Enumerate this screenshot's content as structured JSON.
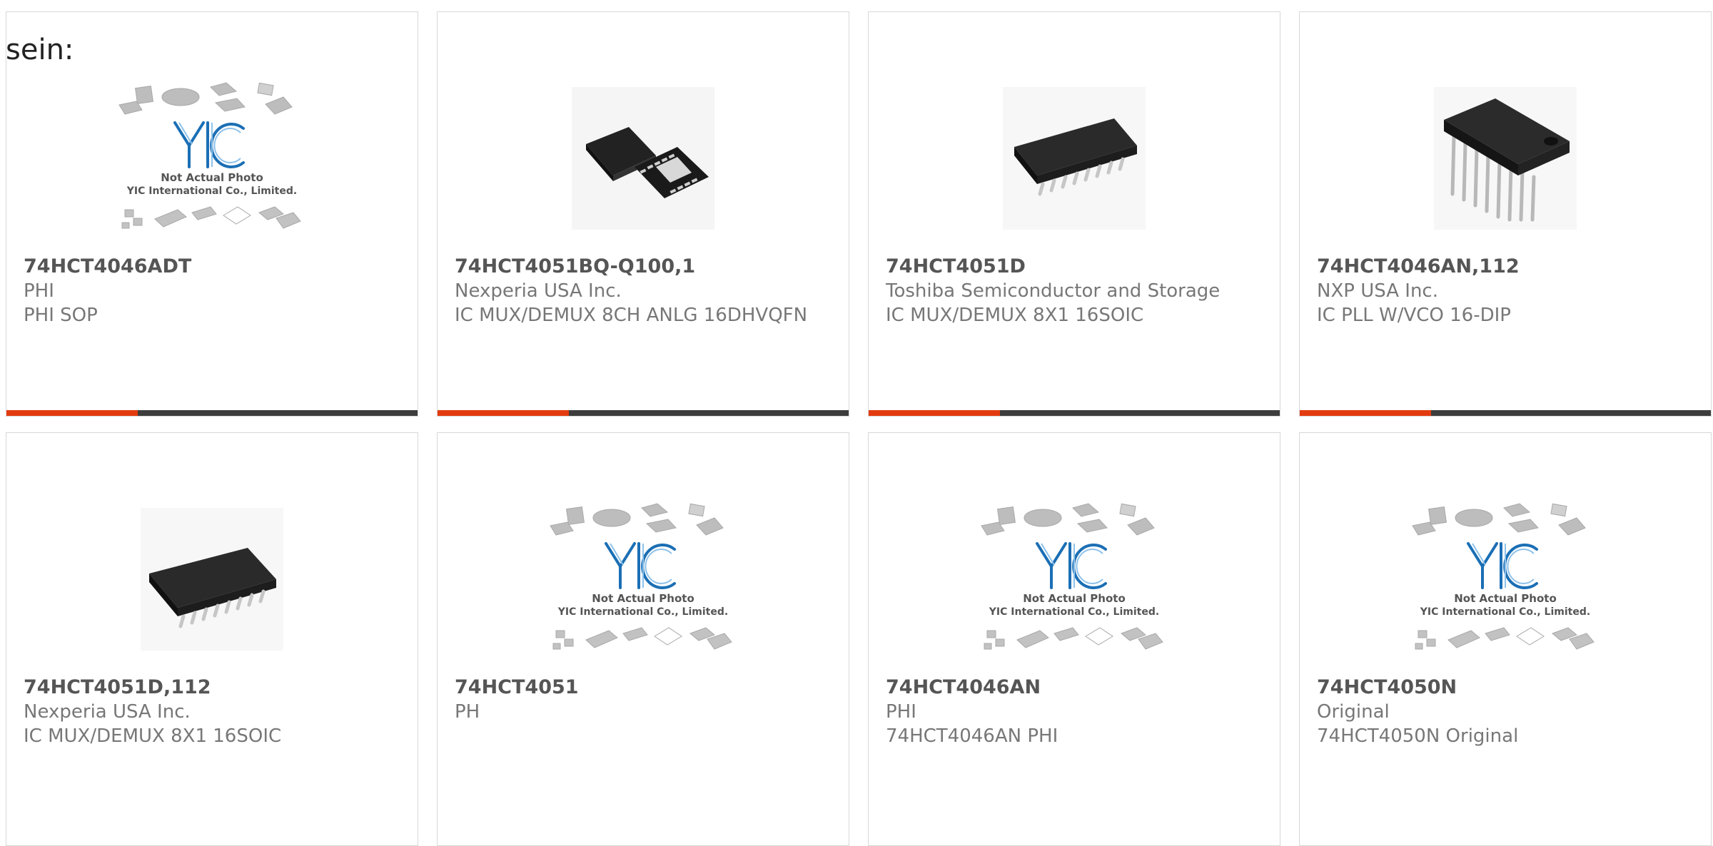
{
  "intro_text": "sein:",
  "placeholder_image": {
    "caption_line1": "Not Actual Photo",
    "caption_line2": "YIC International Co., Limited."
  },
  "products": [
    {
      "part_number": "74HCT4046ADT",
      "manufacturer": "PHI",
      "description": "PHI SOP",
      "image": "placeholder",
      "progress": 0.32
    },
    {
      "part_number": "74HCT4051BQ-Q100,1",
      "manufacturer": "Nexperia USA Inc.",
      "description": "IC MUX/DEMUX 8CH ANLG 16DHVQFN",
      "image": "qfn-chip",
      "progress": 0.32
    },
    {
      "part_number": "74HCT4051D",
      "manufacturer": "Toshiba Semiconductor and Storage",
      "description": "IC MUX/DEMUX 8X1 16SOIC",
      "image": "soic-chip",
      "progress": 0.32
    },
    {
      "part_number": "74HCT4046AN,112",
      "manufacturer": "NXP USA Inc.",
      "description": "IC PLL W/VCO 16-DIP",
      "image": "dip-chip",
      "progress": 0.32
    },
    {
      "part_number": "74HCT4051D,112",
      "manufacturer": "Nexperia USA Inc.",
      "description": "IC MUX/DEMUX 8X1 16SOIC",
      "image": "soic-chip"
    },
    {
      "part_number": "74HCT4051",
      "manufacturer": "PH",
      "description": "",
      "image": "placeholder"
    },
    {
      "part_number": "74HCT4046AN",
      "manufacturer": "PHI",
      "description": "74HCT4046AN PHI",
      "image": "placeholder"
    },
    {
      "part_number": "74HCT4050N",
      "manufacturer": "Original",
      "description": "74HCT4050N Original",
      "image": "placeholder"
    }
  ],
  "colors": {
    "accent": "#e23b0f",
    "bar_track": "#3d3d3d",
    "logo_blue": "#1b6fb5"
  }
}
